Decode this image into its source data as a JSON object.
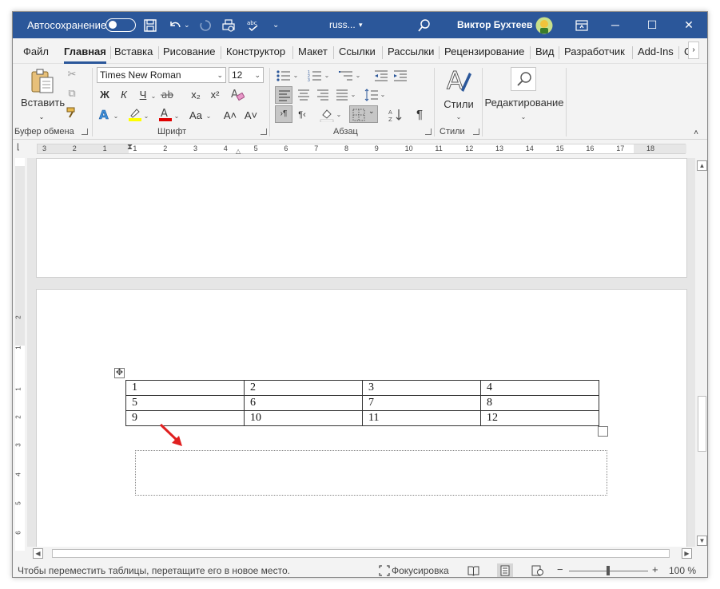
{
  "titlebar": {
    "autosave_label": "Автосохранение",
    "filename": "russ...",
    "user": "Виктор Бухтеев"
  },
  "tabs": [
    "Файл",
    "Главная",
    "Вставка",
    "Рисование",
    "Конструктор",
    "Макет",
    "Ссылки",
    "Рассылки",
    "Рецензирование",
    "Вид",
    "Разработчик",
    "Add-Ins",
    "С"
  ],
  "active_tab": "Главная",
  "ribbon": {
    "paste_label": "Вставить",
    "font_name": "Times New Roman",
    "font_size": "12",
    "bold": "Ж",
    "italic": "К",
    "underline": "Ч",
    "subscript": "x₂",
    "superscript": "x²",
    "change_case": "Aa",
    "grow_font": "A˄",
    "shrink_font": "A˅",
    "para_mark": "¶",
    "styles_label": "Стили",
    "editing_label": "Редактирование",
    "group_clipboard": "Буфер обмена",
    "group_font": "Шрифт",
    "group_paragraph": "Абзац",
    "group_styles": "Стили"
  },
  "ruler": {
    "h_labels": [
      "3",
      "2",
      "1",
      "1",
      "2",
      "3",
      "4",
      "5",
      "6",
      "7",
      "8",
      "9",
      "10",
      "11",
      "12",
      "13",
      "14",
      "15",
      "16",
      "17",
      "18"
    ],
    "v_labels": [
      "2",
      "1",
      "1",
      "2",
      "3",
      "4",
      "5",
      "6"
    ]
  },
  "table": {
    "rows": [
      [
        "1",
        "2",
        "3",
        "4"
      ],
      [
        "5",
        "6",
        "7",
        "8"
      ],
      [
        "9",
        "10",
        "11",
        "12"
      ]
    ]
  },
  "statusbar": {
    "hint": "Чтобы переместить таблицы, перетащите его в новое место.",
    "focus_label": "Фокусировка",
    "zoom_minus": "−",
    "zoom_plus": "+",
    "zoom": "100 %"
  },
  "colors": {
    "titlebar": "#2b579a",
    "arrow": "#e02020",
    "highlight_yellow": "#ffff00",
    "font_red": "#e00000"
  }
}
